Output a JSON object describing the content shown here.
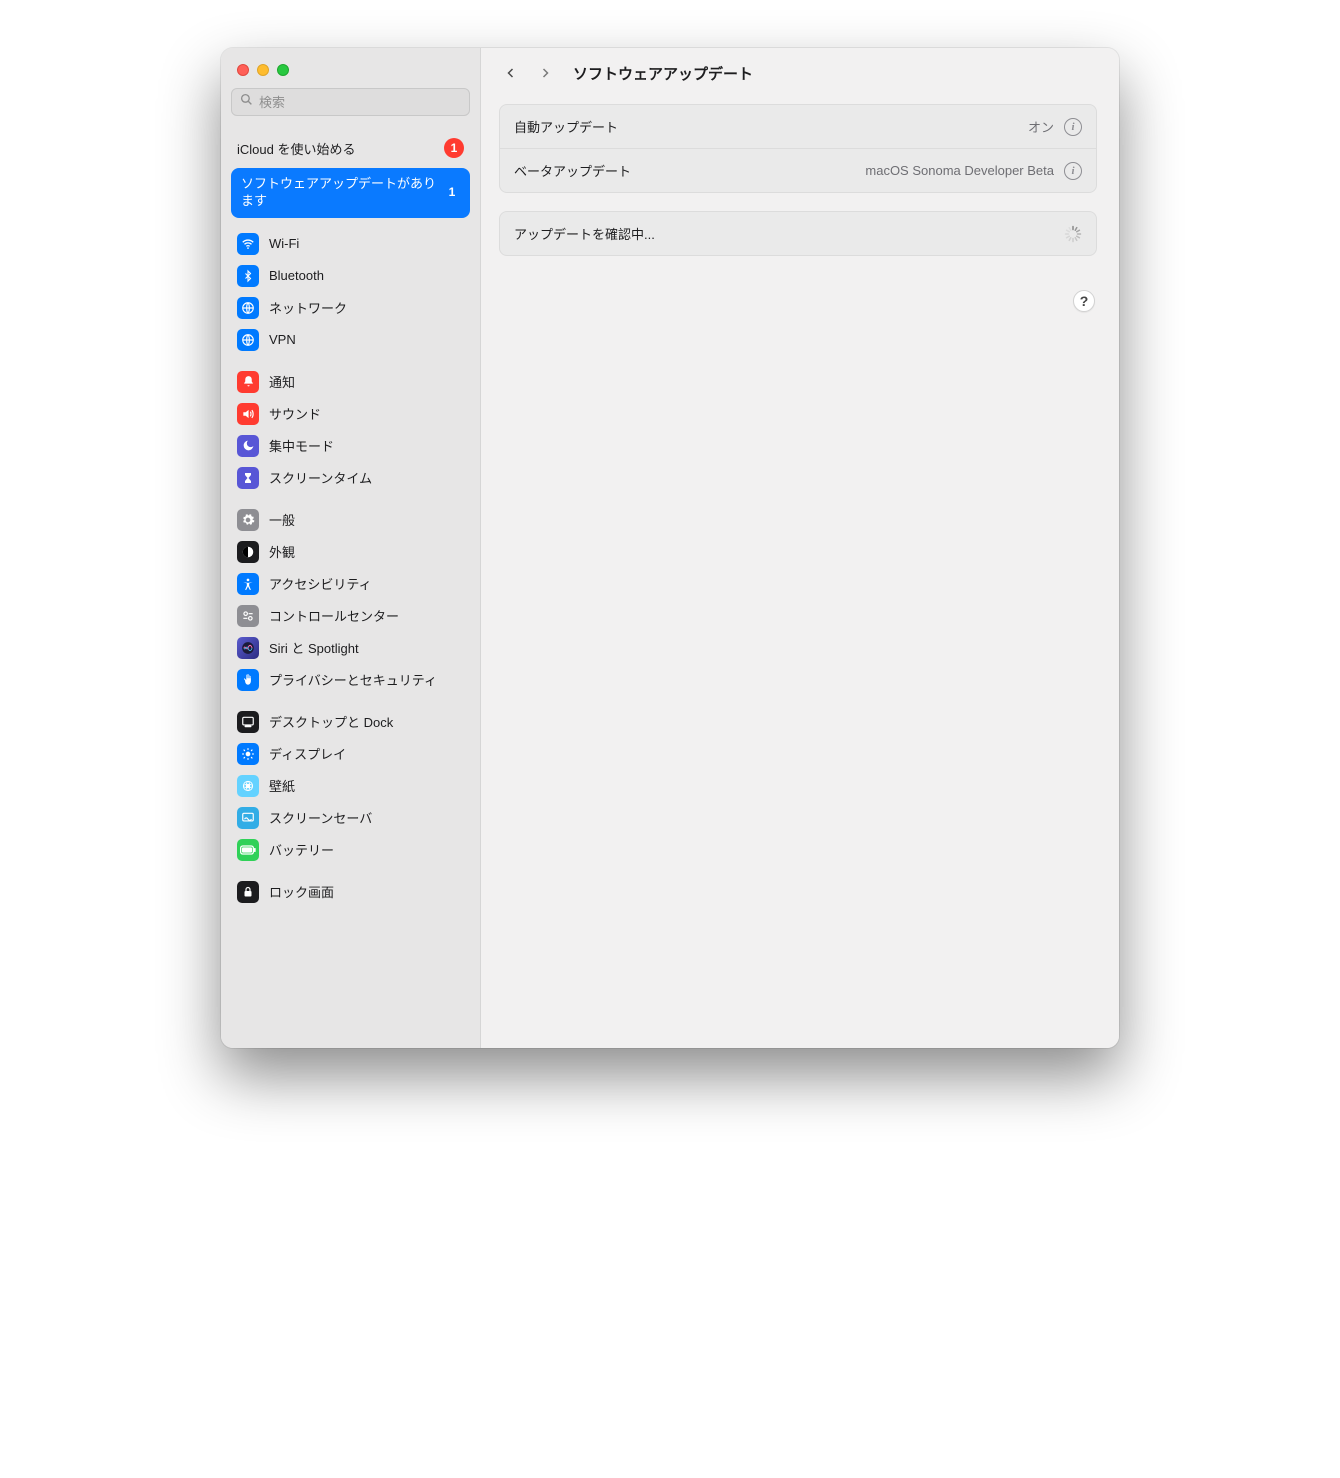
{
  "window": {
    "title": "ソフトウェアアップデート"
  },
  "search": {
    "placeholder": "検索"
  },
  "icloud": {
    "label": "iCloud を使い始める",
    "badge": "1"
  },
  "update_banner": {
    "text": "ソフトウェアアップデートがあります",
    "badge": "1"
  },
  "main": {
    "auto_update": {
      "label": "自動アップデート",
      "value": "オン"
    },
    "beta_update": {
      "label": "ベータアップデート",
      "value": "macOS Sonoma Developer Beta"
    },
    "checking": {
      "label": "アップデートを確認中..."
    }
  },
  "sidebar": {
    "sections": [
      [
        {
          "label": "Wi-Fi",
          "color": "ic-blue",
          "glyph": "wifi"
        },
        {
          "label": "Bluetooth",
          "color": "ic-blue",
          "glyph": "bt"
        },
        {
          "label": "ネットワーク",
          "color": "ic-blue",
          "glyph": "net"
        },
        {
          "label": "VPN",
          "color": "ic-blue",
          "glyph": "vpn"
        }
      ],
      [
        {
          "label": "通知",
          "color": "ic-red",
          "glyph": "bell"
        },
        {
          "label": "サウンド",
          "color": "ic-red",
          "glyph": "sound"
        },
        {
          "label": "集中モード",
          "color": "ic-purple",
          "glyph": "moon"
        },
        {
          "label": "スクリーンタイム",
          "color": "ic-purple",
          "glyph": "hourglass"
        }
      ],
      [
        {
          "label": "一般",
          "color": "ic-gray",
          "glyph": "gear"
        },
        {
          "label": "外観",
          "color": "ic-black",
          "glyph": "appearance"
        },
        {
          "label": "アクセシビリティ",
          "color": "ic-blue",
          "glyph": "accessibility"
        },
        {
          "label": "コントロールセンター",
          "color": "ic-gray",
          "glyph": "cc"
        },
        {
          "label": "Siri と Spotlight",
          "color": "ic-indigo",
          "glyph": "siri"
        },
        {
          "label": "プライバシーとセキュリティ",
          "color": "ic-blue",
          "glyph": "hand"
        }
      ],
      [
        {
          "label": "デスクトップと Dock",
          "color": "ic-black",
          "glyph": "dock"
        },
        {
          "label": "ディスプレイ",
          "color": "ic-blue",
          "glyph": "display"
        },
        {
          "label": "壁紙",
          "color": "ic-cyan",
          "glyph": "wallpaper"
        },
        {
          "label": "スクリーンセーバ",
          "color": "ic-teal",
          "glyph": "screensaver"
        },
        {
          "label": "バッテリー",
          "color": "ic-green",
          "glyph": "battery"
        }
      ],
      [
        {
          "label": "ロック画面",
          "color": "ic-black",
          "glyph": "lock"
        }
      ]
    ]
  }
}
